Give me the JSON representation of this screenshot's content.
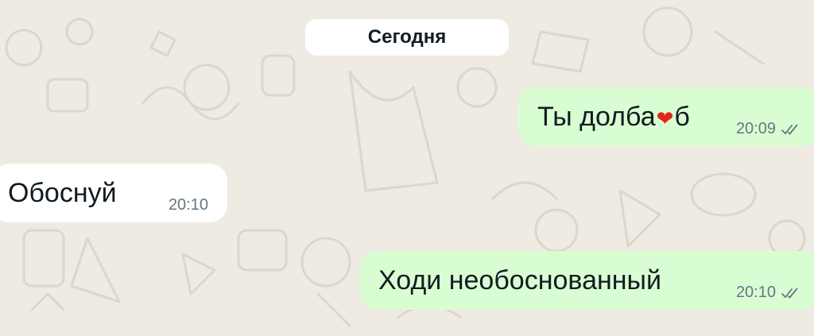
{
  "chat": {
    "day_label": "Сегодня",
    "messages": [
      {
        "direction": "outgoing",
        "text_before": "Ты долба",
        "covered_glyph": "❤",
        "text_after": "б",
        "time": "20:09",
        "status": "read-double-check"
      },
      {
        "direction": "incoming",
        "text": "Обоснуй",
        "time": "20:10"
      },
      {
        "direction": "outgoing",
        "text": "Ходи необоснованный",
        "time": "20:10",
        "status": "read-double-check"
      }
    ]
  },
  "colors": {
    "wallpaper": "#efeae2",
    "outgoing_bubble": "#d9fdd3",
    "incoming_bubble": "#ffffff",
    "timestamp": "#667781",
    "heart": "#e0261c"
  }
}
